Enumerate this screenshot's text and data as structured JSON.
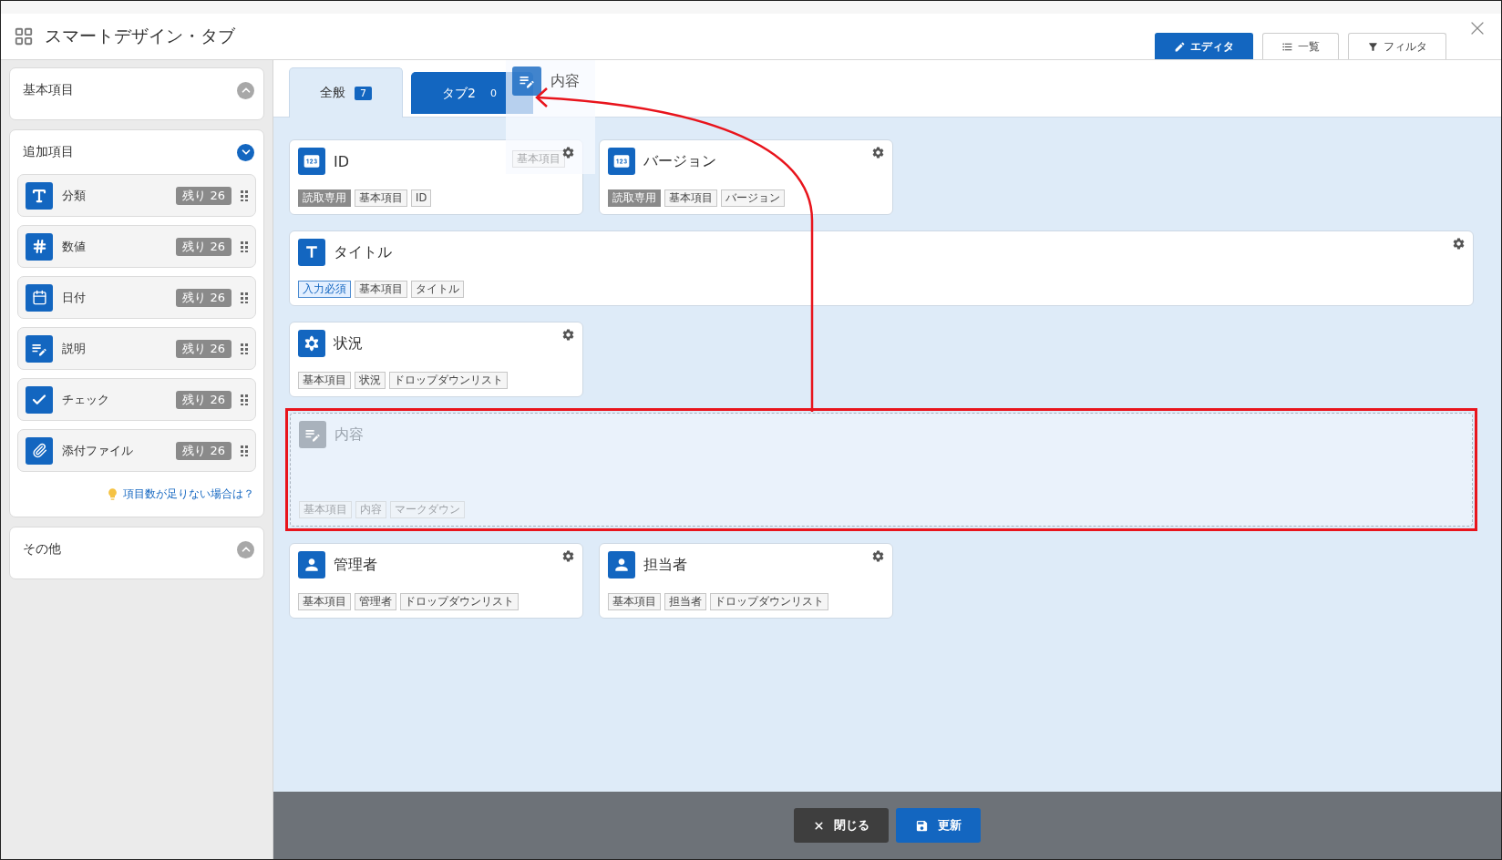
{
  "window": {
    "title": "スマートデザイン・タブ"
  },
  "view_tabs": [
    {
      "label": "エディタ",
      "selected": true,
      "kind": "editor"
    },
    {
      "label": "一覧",
      "selected": false,
      "kind": "list"
    },
    {
      "label": "フィルタ",
      "selected": false,
      "kind": "filter"
    }
  ],
  "sidebar": {
    "sections": [
      {
        "title": "基本項目",
        "expanded": false
      },
      {
        "title": "追加項目",
        "expanded": true,
        "items": [
          {
            "kind": "text",
            "label": "分類",
            "badge": "残り 26"
          },
          {
            "kind": "number",
            "label": "数値",
            "badge": "残り 26"
          },
          {
            "kind": "date",
            "label": "日付",
            "badge": "残り 26"
          },
          {
            "kind": "note",
            "label": "説明",
            "badge": "残り 26"
          },
          {
            "kind": "check",
            "label": "チェック",
            "badge": "残り 26"
          },
          {
            "kind": "attachment",
            "label": "添付ファイル",
            "badge": "残り 26"
          }
        ],
        "hint": "項目数が足りない場合は？"
      },
      {
        "title": "その他",
        "expanded": false
      }
    ]
  },
  "tabs": [
    {
      "label": "全般",
      "count": "7",
      "selected": true
    },
    {
      "label": "タブ2",
      "count": "0",
      "selected": false
    }
  ],
  "fields": [
    {
      "kind": "id",
      "title": "ID",
      "dragging": false,
      "tags": [
        {
          "text": "読取専用",
          "kind": "readonly"
        },
        {
          "text": "基本項目",
          "kind": "plain"
        },
        {
          "text": "ID",
          "kind": "plain"
        }
      ]
    },
    {
      "kind": "id",
      "title": "バージョン",
      "dragging": false,
      "tags": [
        {
          "text": "読取専用",
          "kind": "readonly"
        },
        {
          "text": "基本項目",
          "kind": "plain"
        },
        {
          "text": "バージョン",
          "kind": "plain"
        }
      ]
    },
    {
      "kind": "title",
      "title": "タイトル",
      "dragging": false,
      "tags": [
        {
          "text": "入力必須",
          "kind": "required"
        },
        {
          "text": "基本項目",
          "kind": "plain"
        },
        {
          "text": "タイトル",
          "kind": "plain"
        }
      ]
    },
    {
      "kind": "status",
      "title": "状況",
      "dragging": false,
      "tags": [
        {
          "text": "基本項目",
          "kind": "plain"
        },
        {
          "text": "状況",
          "kind": "plain"
        },
        {
          "text": "ドロップダウンリスト",
          "kind": "plain"
        }
      ]
    },
    {
      "kind": "note",
      "title": "内容",
      "dragging": true,
      "tags": [
        {
          "text": "基本項目",
          "kind": "plain"
        },
        {
          "text": "内容",
          "kind": "plain"
        },
        {
          "text": "マークダウン",
          "kind": "plain"
        }
      ]
    },
    {
      "kind": "person",
      "title": "管理者",
      "dragging": false,
      "tags": [
        {
          "text": "基本項目",
          "kind": "plain"
        },
        {
          "text": "管理者",
          "kind": "plain"
        },
        {
          "text": "ドロップダウンリスト",
          "kind": "plain"
        }
      ]
    },
    {
      "kind": "person",
      "title": "担当者",
      "dragging": false,
      "tags": [
        {
          "text": "基本項目",
          "kind": "plain"
        },
        {
          "text": "担当者",
          "kind": "plain"
        },
        {
          "text": "ドロップダウンリスト",
          "kind": "plain"
        }
      ]
    }
  ],
  "drag_preview": {
    "kind": "note",
    "title": "内容",
    "tags": [
      "基本項目"
    ]
  },
  "footer": {
    "buttons": [
      {
        "label": "閉じる",
        "kind": "close"
      },
      {
        "label": "更新",
        "kind": "save"
      }
    ]
  }
}
